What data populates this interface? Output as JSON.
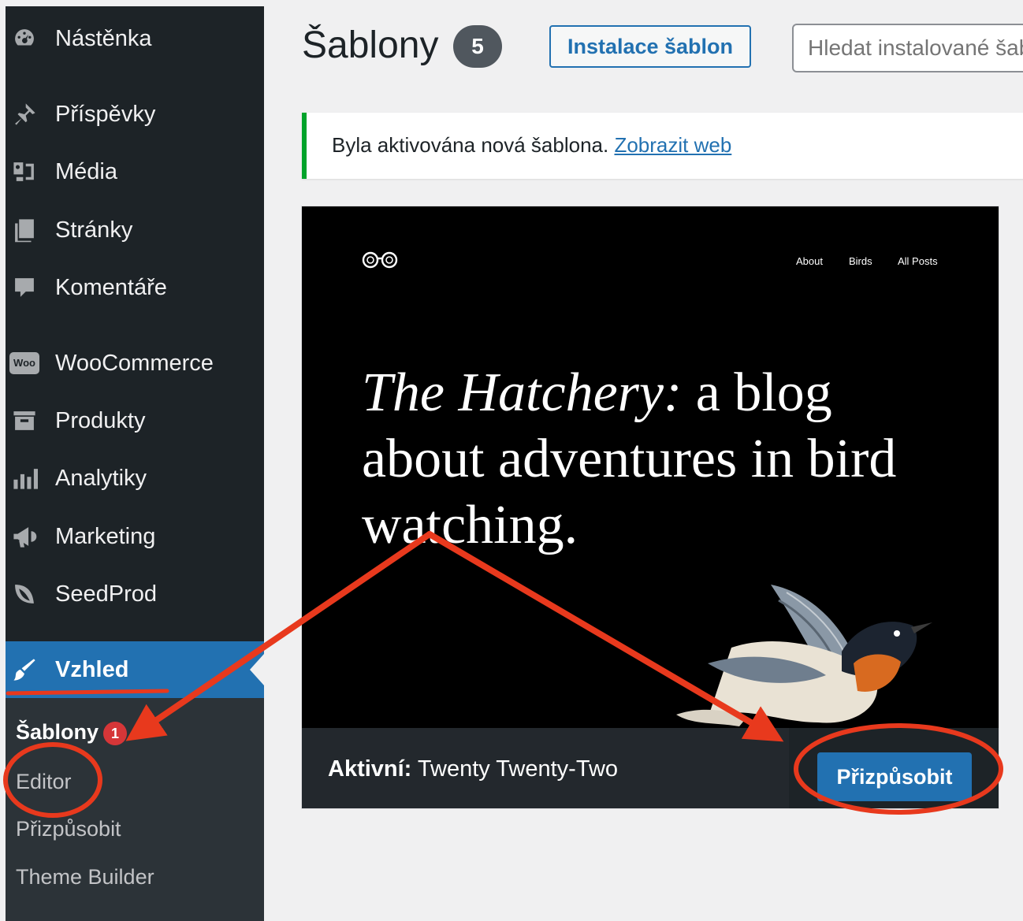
{
  "sidebar": {
    "items": [
      {
        "label": "Nástěnka",
        "icon": "dashboard-icon"
      },
      {
        "label": "Příspěvky",
        "icon": "pin-icon"
      },
      {
        "label": "Média",
        "icon": "media-icon"
      },
      {
        "label": "Stránky",
        "icon": "pages-icon"
      },
      {
        "label": "Komentáře",
        "icon": "comment-icon"
      },
      {
        "label": "WooCommerce",
        "icon": "woo-icon"
      },
      {
        "label": "Produkty",
        "icon": "archive-icon"
      },
      {
        "label": "Analytiky",
        "icon": "chart-bar-icon"
      },
      {
        "label": "Marketing",
        "icon": "megaphone-icon"
      },
      {
        "label": "SeedProd",
        "icon": "seedprod-icon"
      },
      {
        "label": "Vzhled",
        "icon": "paintbrush-icon"
      }
    ],
    "woo_icon_text": "Woo",
    "submenu": {
      "themes": "Šablony",
      "themes_badge": "1",
      "editor": "Editor",
      "customize": "Přizpůsobit",
      "theme_builder": "Theme Builder"
    }
  },
  "header": {
    "title": "Šablony",
    "count": "5",
    "install_label": "Instalace šablon",
    "search_placeholder": "Hledat instalované šablony..."
  },
  "notice": {
    "text": "Byla aktivována nová šablona.",
    "link": "Zobrazit web"
  },
  "theme_preview": {
    "nav": [
      "About",
      "Birds",
      "All Posts"
    ],
    "headline_italic": "The Hatchery:",
    "headline_rest": " a blog about adventures in bird watching."
  },
  "active_theme": {
    "prefix": "Aktivní:",
    "name": "Twenty Twenty-Two",
    "customize_label": "Přizpůsobit"
  },
  "colors": {
    "sidebar_bg": "#1d2327",
    "submenu_bg": "#2c3338",
    "accent": "#2271b1",
    "notice_success": "#00a32a",
    "annotation": "#e8391d"
  }
}
